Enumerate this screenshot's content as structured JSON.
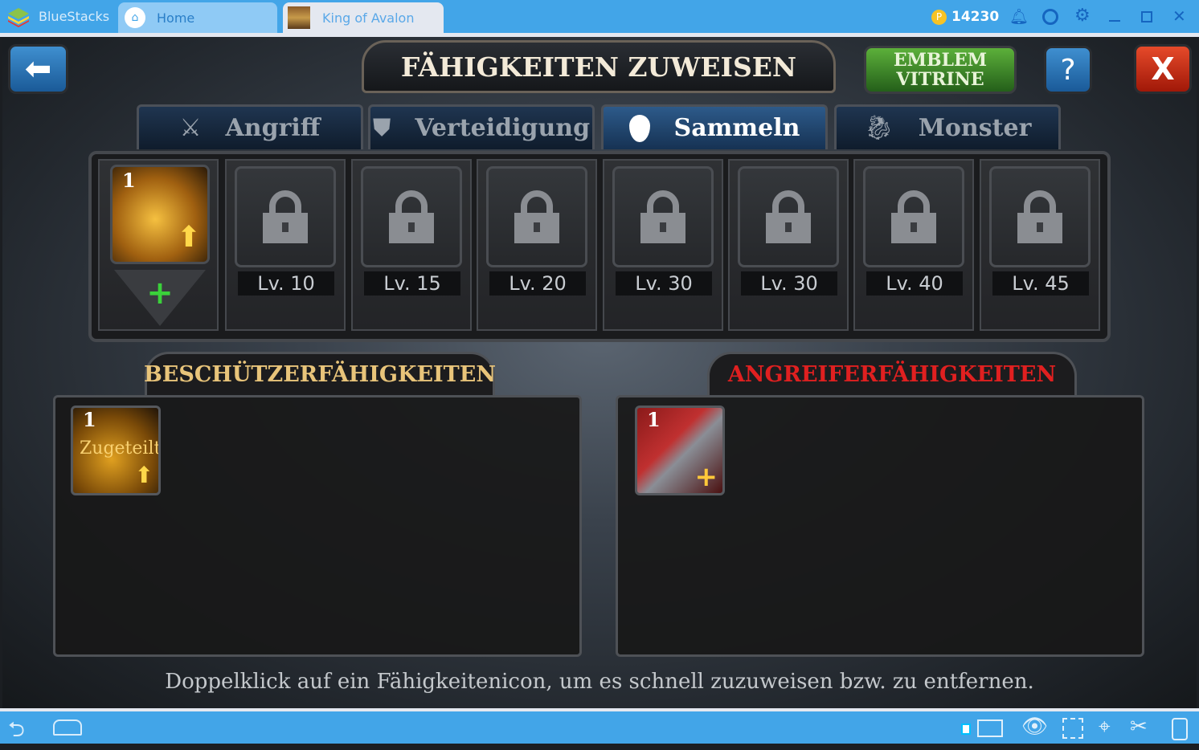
{
  "window": {
    "app_name": "BlueStacks",
    "tabs": [
      {
        "label": "Home"
      },
      {
        "label": "King of Avalon"
      }
    ],
    "coins": "14230",
    "accent": "#42a5e8"
  },
  "game": {
    "title": "FÄHIGKEITEN ZUWEISEN",
    "emblem_button": [
      "EMBLEM",
      "VITRINE"
    ],
    "help_label": "?",
    "close_label": "X",
    "tabs": [
      {
        "label": "Angriff",
        "icon": "crossed-swords-icon"
      },
      {
        "label": "Verteidigung",
        "icon": "shield-icon"
      },
      {
        "label": "Sammeln",
        "icon": "map-pin-icon",
        "active": true
      },
      {
        "label": "Monster",
        "icon": "dragon-icon"
      }
    ],
    "first_slot": {
      "count": "1"
    },
    "locked_slots": [
      {
        "level": "Lv. 10"
      },
      {
        "level": "Lv. 15"
      },
      {
        "level": "Lv. 20"
      },
      {
        "level": "Lv. 30"
      },
      {
        "level": "Lv. 30"
      },
      {
        "level": "Lv. 40"
      },
      {
        "level": "Lv. 45"
      }
    ],
    "defender": {
      "title": "BESCHÜTZERFÄHIGKEITEN",
      "color": "#e8c47a",
      "skill": {
        "count": "1",
        "status": "Zugeteilt"
      }
    },
    "attacker": {
      "title": "ANGREIFERFÄHIGKEITEN",
      "color": "#e02020",
      "skill": {
        "count": "1"
      }
    },
    "hint": "Doppelklick auf ein Fähigkeitenicon, um es schnell zuzuweisen bzw. zu entfernen."
  }
}
